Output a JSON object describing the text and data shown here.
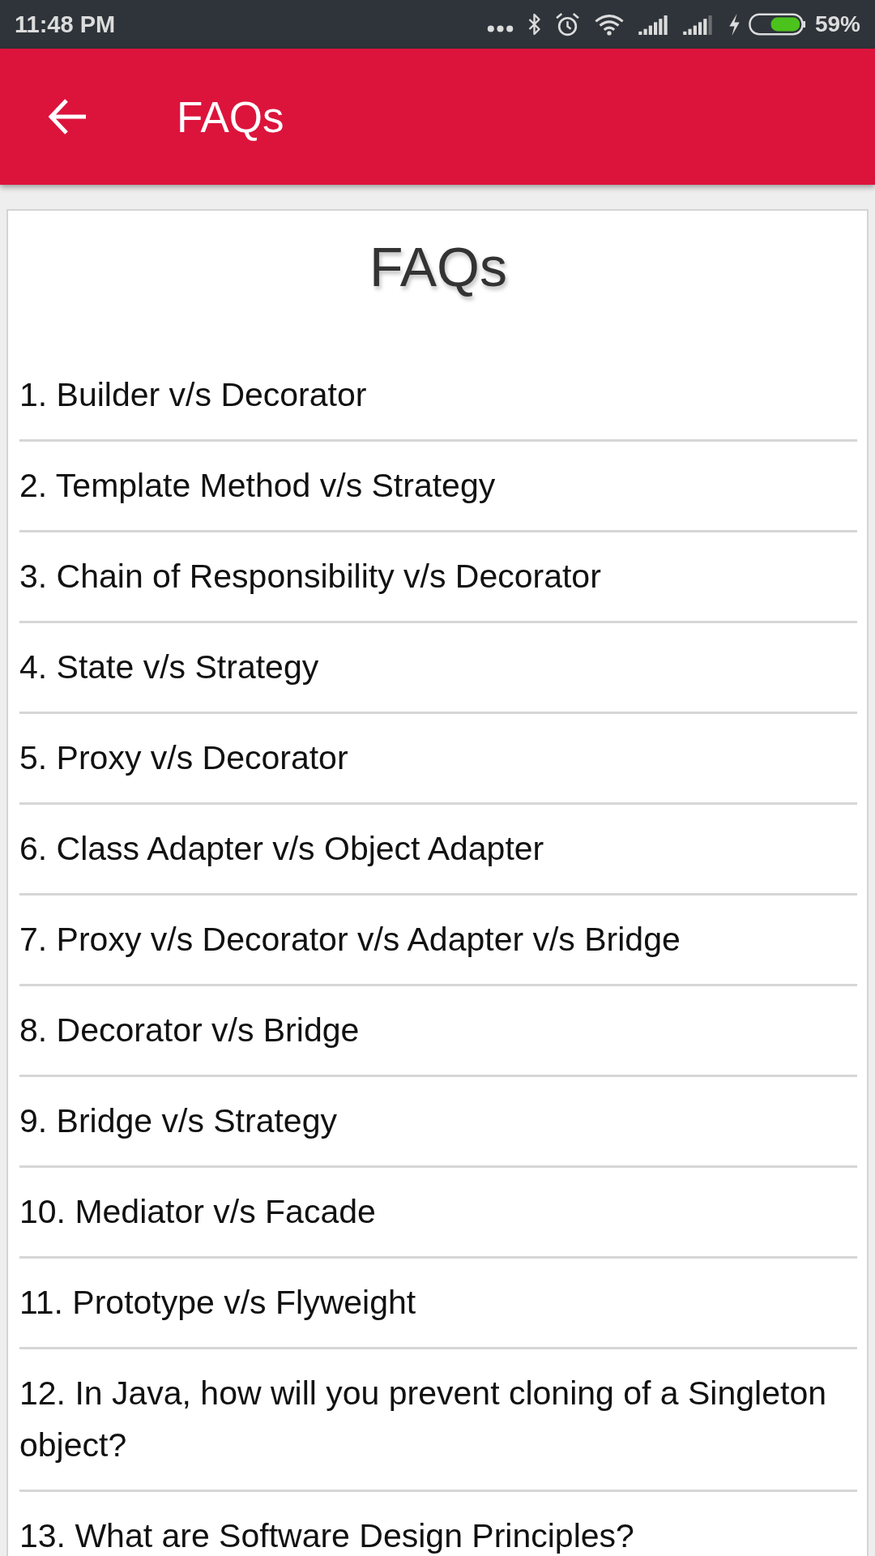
{
  "status_bar": {
    "time": "11:48 PM",
    "battery": "59%"
  },
  "app_bar": {
    "title": "FAQs"
  },
  "heading": "FAQs",
  "faqs": [
    "1. Builder v/s Decorator",
    "2. Template Method v/s Strategy",
    "3. Chain of Responsibility v/s Decorator",
    "4. State v/s Strategy",
    "5. Proxy v/s Decorator",
    "6. Class Adapter v/s Object Adapter",
    "7. Proxy v/s Decorator v/s Adapter v/s Bridge",
    "8. Decorator v/s Bridge",
    "9. Bridge v/s Strategy",
    "10. Mediator v/s Facade",
    "11. Prototype v/s Flyweight",
    "12. In Java, how will you prevent cloning of a Singleton object?",
    "13. What are Software Design Principles?"
  ]
}
